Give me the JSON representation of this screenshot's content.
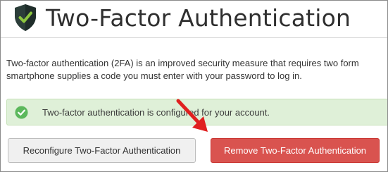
{
  "header": {
    "title": "Two-Factor Authentication",
    "icon": "shield-check-icon"
  },
  "description": {
    "line1": "Two-factor authentication (2FA) is an improved security measure that requires two form",
    "line2": "smartphone supplies a code you must enter with your password to log in."
  },
  "status_alert": {
    "text": "Two-factor authentication is configured for your account.",
    "icon": "check-circle-icon",
    "background": "#dff0d8",
    "icon_color": "#5cb85c"
  },
  "buttons": {
    "reconfigure_label": "Reconfigure Two-Factor Authentication",
    "remove_label": "Remove Two-Factor Authentication",
    "remove_color": "#d9534f"
  },
  "annotation": {
    "icon": "red-arrow-icon",
    "color": "#e02020"
  }
}
